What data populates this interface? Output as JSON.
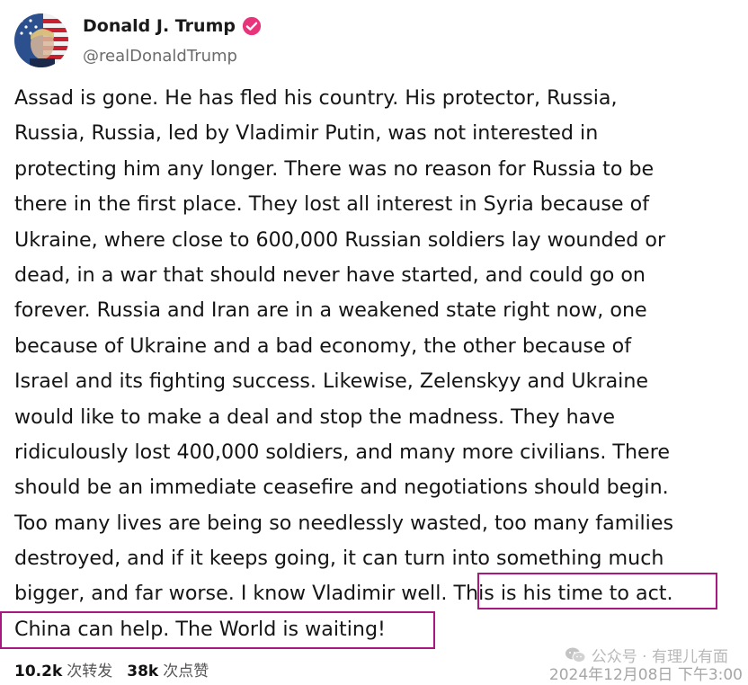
{
  "author": {
    "name": "Donald J. Trump",
    "handle": "@realDonaldTrump"
  },
  "post": {
    "lines": [
      "Assad is gone. He has fled his country. His protector, Russia,",
      "Russia, Russia, led by Vladimir Putin, was not interested in",
      "protecting him any longer. There was no reason for Russia to be",
      "there in the first place. They lost all interest in Syria because of",
      "Ukraine, where close to 600,000 Russian soldiers lay wounded or",
      "dead, in a war that should never have started, and could go on",
      "forever. Russia and Iran are in a weakened state right now, one",
      "because of Ukraine and a bad economy, the other because of",
      "Israel and its fighting success. Likewise, Zelenskyy and Ukraine",
      "would like to make a deal and stop the madness. They have",
      "ridiculously lost 400,000 soldiers, and many more civilians. There",
      "should be an immediate ceasefire and negotiations should begin.",
      "Too many lives are being so needlessly wasted, too many families",
      "destroyed, and if it keeps going, it can turn into something much",
      "bigger, and far worse. I know Vladimir well. This is his time to act.",
      "China can help. The World is waiting!"
    ]
  },
  "stats": {
    "reposts_count": "10.2k",
    "reposts_label": "次转发",
    "likes_count": "38k",
    "likes_label": "次点赞"
  },
  "watermark": {
    "text": "公众号 · 有理儿有面"
  },
  "timestamp": "2024年12月08日 下午3:00",
  "colors": {
    "verified_badge": "#e8347a",
    "highlight_border": "#a8197f",
    "text": "#151515",
    "handle": "#6b6b6b"
  }
}
